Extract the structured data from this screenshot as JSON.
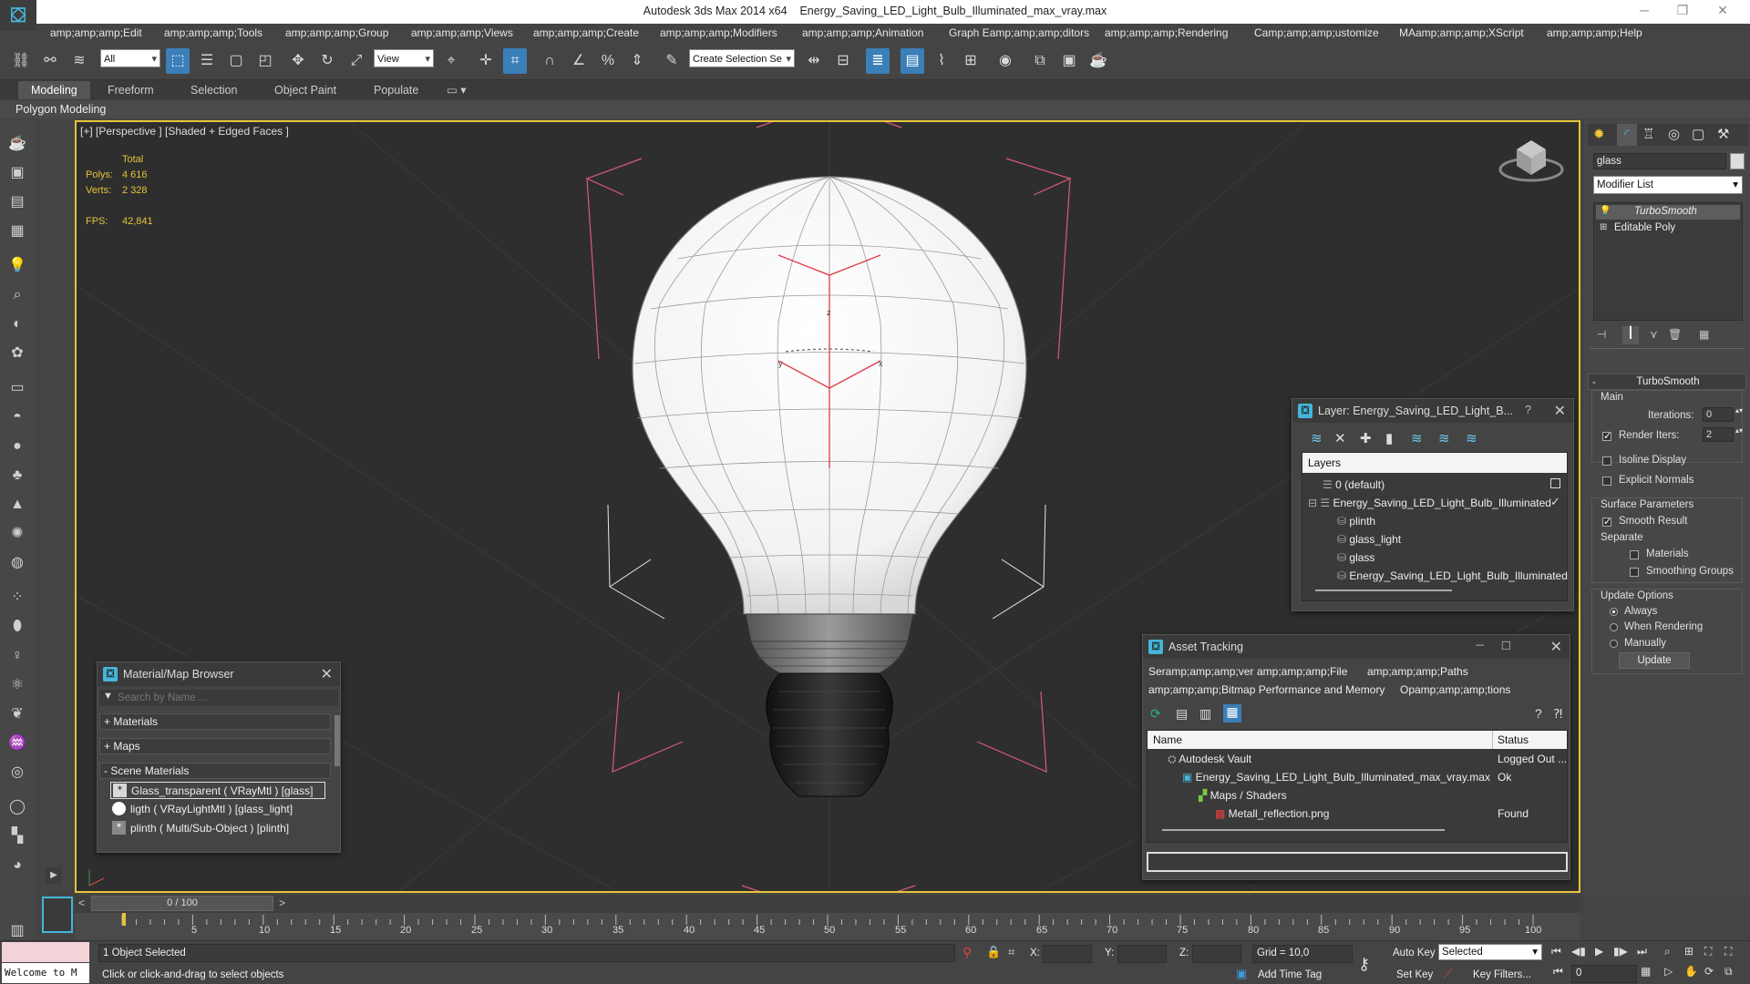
{
  "titlebar": {
    "app_title": "Autodesk 3ds Max  2014 x64",
    "file_name": "Energy_Saving_LED_Light_Bulb_Illuminated_max_vray.max",
    "logo": "3ds-max-logo",
    "minimize": "─",
    "restore": "❐",
    "close": "✕"
  },
  "menubar": {
    "items": [
      "amp;amp;amp;Edit",
      "amp;amp;amp;Tools",
      "amp;amp;amp;Group",
      "amp;amp;amp;Views",
      "amp;amp;amp;Create",
      "amp;amp;amp;Modifiers",
      "amp;amp;amp;Animation",
      "Graph Eamp;amp;amp;ditors",
      "amp;amp;amp;Rendering",
      "Camp;amp;amp;ustomize",
      "MAamp;amp;amp;XScript",
      "amp;amp;amp;Help"
    ]
  },
  "toolbar": {
    "selection_filter": "All",
    "ref_coord": "View",
    "named_selection": "Create Selection Se"
  },
  "ribbon": {
    "tabs": [
      "Modeling",
      "Freeform",
      "Selection",
      "Object Paint",
      "Populate"
    ],
    "active_tab": "Modeling",
    "panel_label": "Polygon Modeling"
  },
  "viewport": {
    "label": "[+] [Perspective ] [Shaded + Edged Faces ]",
    "stats": {
      "total_label": "Total",
      "polys_label": "Polys:",
      "polys_value": "4 616",
      "verts_label": "Verts:",
      "verts_value": "2 328",
      "fps_label": "FPS:",
      "fps_value": "42,841"
    }
  },
  "command_panel": {
    "object_name": "glass",
    "modifier_list": "Modifier List",
    "stack": [
      "TurboSmooth",
      "Editable Poly"
    ],
    "rollout_title": "TurboSmooth",
    "main_label": "Main",
    "iterations_label": "Iterations:",
    "iterations_value": "0",
    "render_iters_label": "Render Iters:",
    "render_iters_value": "2",
    "isoline_label": "Isoline Display",
    "explicit_normals_label": "Explicit Normals",
    "surface_params_label": "Surface Parameters",
    "smooth_result_label": "Smooth Result",
    "separate_label": "Separate",
    "materials_label": "Materials",
    "smoothing_groups_label": "Smoothing Groups",
    "update_options_label": "Update Options",
    "always_label": "Always",
    "when_rendering_label": "When Rendering",
    "manually_label": "Manually",
    "update_button": "Update"
  },
  "layer_dialog": {
    "title": "Layer: Energy_Saving_LED_Light_B...",
    "help": "?",
    "column": "Layers",
    "rows": [
      "0 (default)",
      "Energy_Saving_LED_Light_Bulb_Illuminated",
      "plinth",
      "glass_light",
      "glass",
      "Energy_Saving_LED_Light_Bulb_Illuminated"
    ]
  },
  "asset_tracking": {
    "title": "Asset Tracking",
    "menu1": [
      "Seramp;amp;amp;ver",
      "amp;amp;amp;File",
      "amp;amp;amp;Paths"
    ],
    "menu2": [
      "amp;amp;amp;Bitmap Performance and Memory",
      "Opamp;amp;amp;tions"
    ],
    "col_name": "Name",
    "col_status": "Status",
    "rows": [
      {
        "name": "Autodesk Vault",
        "status": "Logged Out ..."
      },
      {
        "name": "Energy_Saving_LED_Light_Bulb_Illuminated_max_vray.max",
        "status": "Ok"
      },
      {
        "name": "Maps / Shaders",
        "status": ""
      },
      {
        "name": "Metall_reflection.png",
        "status": "Found"
      }
    ]
  },
  "material_browser": {
    "title": "Material/Map Browser",
    "search_placeholder": "Search by Name ...",
    "sections": [
      "+ Materials",
      "+ Maps",
      "- Scene Materials"
    ],
    "materials": [
      "Glass_transparent ( VRayMtl ) [glass]",
      "ligth ( VRayLightMtl ) [glass_light]",
      "plinth ( Multi/Sub-Object ) [plinth]"
    ]
  },
  "timeline": {
    "frame_display": "0 / 100",
    "ticks": [
      "5",
      "10",
      "15",
      "20",
      "25",
      "30",
      "35",
      "40",
      "45",
      "50",
      "55",
      "60",
      "65",
      "70",
      "75",
      "80",
      "85",
      "90",
      "95",
      "100"
    ]
  },
  "statusbar": {
    "selection_count": "1 Object Selected",
    "prompt": "Click or click-and-drag to select objects",
    "listener": "Welcome to M",
    "x_label": "X:",
    "y_label": "Y:",
    "z_label": "Z:",
    "grid": "Grid = 10,0",
    "add_time_tag": "Add Time Tag",
    "auto_key": "Auto Key",
    "key_mode": "Selected",
    "set_key": "Set Key",
    "key_filters": "Key Filters...",
    "current_frame": "0"
  }
}
